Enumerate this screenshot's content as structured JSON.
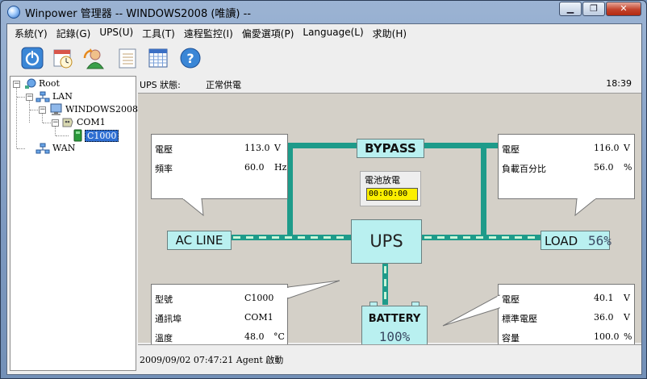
{
  "window": {
    "title": "Winpower 管理器 -- WINDOWS2008 (唯讀) --",
    "minimize": "▁",
    "restore": "❐",
    "close": "✕"
  },
  "menu": [
    {
      "label": "系統(Y)",
      "key": "Y"
    },
    {
      "label": "記錄(G)",
      "key": "G"
    },
    {
      "label": "UPS(U)",
      "key": "U"
    },
    {
      "label": "工具(T)",
      "key": "T"
    },
    {
      "label": "遠程監控(I)",
      "key": "I"
    },
    {
      "label": "偏愛選項(P)",
      "key": "P"
    },
    {
      "label": "Language(L)",
      "key": "L"
    },
    {
      "label": "求助(H)",
      "key": "H"
    }
  ],
  "toolbar": [
    {
      "icon": "power-icon"
    },
    {
      "icon": "schedule-icon"
    },
    {
      "icon": "user-icon"
    },
    {
      "icon": "log-list-icon"
    },
    {
      "icon": "calendar-grid-icon"
    },
    {
      "icon": "help-icon"
    }
  ],
  "tree": {
    "root": "Root",
    "lan": "LAN",
    "host": "WINDOWS2008",
    "port": "COM1",
    "device": "C1000",
    "wan": "WAN"
  },
  "status": {
    "label": "UPS 狀態:",
    "value": "正常供電",
    "time": "18:39"
  },
  "input_info": {
    "rows": [
      {
        "label": "電壓",
        "value": "113.0",
        "unit": "V"
      },
      {
        "label": "頻率",
        "value": "60.0",
        "unit": "Hz"
      }
    ]
  },
  "output_info": {
    "rows": [
      {
        "label": "電壓",
        "value": "116.0",
        "unit": "V"
      },
      {
        "label": "負載百分比",
        "value": "56.0",
        "unit": "%"
      }
    ]
  },
  "ups_info": {
    "rows": [
      {
        "label": "型號",
        "value": "C1000",
        "unit": ""
      },
      {
        "label": "通訊埠",
        "value": "COM1",
        "unit": ""
      },
      {
        "label": "溫度",
        "value": "48.0",
        "unit": "°C"
      }
    ]
  },
  "battery_info": {
    "rows": [
      {
        "label": "電壓",
        "value": "40.1",
        "unit": "V"
      },
      {
        "label": "標準電壓",
        "value": "36.0",
        "unit": "V"
      },
      {
        "label": "容量",
        "value": "100.0",
        "unit": "%"
      }
    ]
  },
  "diagram": {
    "bypass": "BYPASS",
    "discharge_label": "電池放電",
    "discharge_time": "00:00:00",
    "ac_line": "AC LINE",
    "ups": "UPS",
    "load": "LOAD",
    "load_percent": "56%",
    "battery": "BATTERY",
    "battery_percent": "100%"
  },
  "log": {
    "message": "2009/09/02 07:47:21  Agent 啟動"
  },
  "colors": {
    "pipe": "#1e9b8a",
    "pipe_dash": "#c8f4d8",
    "component": "#b9f0f0",
    "lcd_bg": "#fcef00"
  }
}
